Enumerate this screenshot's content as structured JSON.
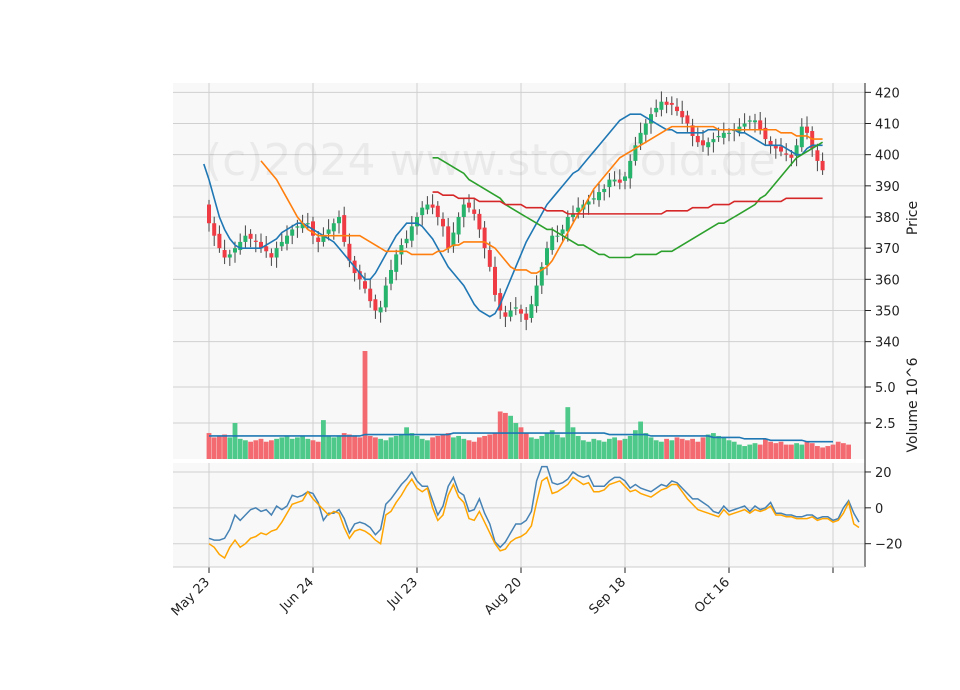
{
  "watermark": "(c)2024 www.stockfold.de",
  "chart_data": {
    "type": "candlestick",
    "x_ticks": [
      {
        "label": "May 23",
        "index": 0
      },
      {
        "label": "Jun 24",
        "index": 20
      },
      {
        "label": "Jul 23",
        "index": 40
      },
      {
        "label": "Aug 20",
        "index": 60
      },
      {
        "label": "Sep 18",
        "index": 80
      },
      {
        "label": "Oct 16",
        "index": 100
      },
      {
        "label": "",
        "index": 120
      }
    ],
    "price_panel": {
      "ylabel": "Price",
      "ylim": [
        337,
        423
      ],
      "yticks": [
        340,
        350,
        360,
        370,
        380,
        390,
        400,
        410,
        420
      ],
      "close": [
        378,
        374,
        370,
        367,
        368,
        370,
        372,
        374,
        373,
        372,
        370,
        369,
        367,
        370,
        372,
        374,
        376,
        377,
        378,
        378,
        374,
        372,
        374,
        376,
        378,
        380,
        372,
        366,
        362,
        360,
        357,
        353,
        350,
        351,
        358,
        363,
        368,
        371,
        373,
        377,
        380,
        383,
        384,
        383,
        380,
        377,
        370,
        375,
        380,
        384,
        383,
        381,
        376,
        370,
        364,
        355,
        350,
        348,
        350,
        351,
        349,
        347,
        352,
        358,
        364,
        370,
        374,
        374,
        376,
        380,
        381,
        383,
        384,
        385,
        386,
        388,
        389,
        392,
        392,
        391,
        393,
        398,
        403,
        407,
        410,
        413,
        415,
        417,
        416,
        416,
        414,
        412,
        410,
        406,
        404,
        403,
        404,
        405,
        406,
        407,
        407,
        408,
        409,
        410,
        411,
        411,
        408,
        405,
        403,
        402,
        401,
        400,
        399,
        403,
        409,
        407,
        402,
        398,
        395
      ],
      "series": [
        {
          "name": "MA10",
          "color": "#1f77b4",
          "values": [
            397,
            392,
            386,
            380,
            376,
            373,
            371,
            370,
            370,
            370,
            370,
            370,
            371,
            372,
            373,
            375,
            376,
            377,
            378,
            378,
            377,
            376,
            375,
            374,
            373,
            372,
            370,
            368,
            366,
            364,
            362,
            360,
            360,
            362,
            365,
            368,
            371,
            374,
            376,
            378,
            378,
            378,
            377,
            375,
            373,
            370,
            367,
            364,
            362,
            360,
            358,
            355,
            352,
            350,
            349,
            348,
            349,
            352,
            356,
            360,
            364,
            368,
            372,
            375,
            378,
            381,
            384,
            386,
            388,
            390,
            392,
            394,
            395,
            397,
            399,
            401,
            403,
            405,
            407,
            409,
            411,
            412,
            413,
            413,
            413,
            412,
            411,
            410,
            409,
            408,
            408,
            407,
            407,
            407,
            407,
            407,
            407,
            408,
            408,
            408,
            408,
            408,
            408,
            407,
            407,
            406,
            405,
            404,
            403,
            403,
            403,
            403,
            402,
            401,
            400,
            400,
            402,
            403,
            403,
            403
          ]
        },
        {
          "name": "MA20",
          "color": "#ff7f0e",
          "values": [
            398,
            396,
            394,
            392,
            389,
            386,
            383,
            380,
            378,
            376,
            375,
            374,
            374,
            374,
            374,
            374,
            374,
            374,
            374,
            374,
            373,
            372,
            371,
            370,
            369,
            369,
            369,
            369,
            369,
            368,
            368,
            368,
            368,
            368,
            369,
            369,
            370,
            371,
            371,
            372,
            372,
            372,
            372,
            372,
            371,
            370,
            368,
            366,
            364,
            363,
            363,
            363,
            362,
            362,
            363,
            364,
            366,
            369,
            372,
            375,
            378,
            381,
            383,
            386,
            389,
            391,
            393,
            395,
            397,
            399,
            400,
            401,
            402,
            403,
            404,
            405,
            406,
            407,
            408,
            409,
            409,
            409,
            409,
            409,
            409,
            409,
            409,
            409,
            408,
            408,
            408,
            408,
            408,
            408,
            408,
            408,
            408,
            408,
            408,
            408,
            407,
            407,
            407,
            406,
            406,
            406,
            405,
            405,
            405
          ]
        },
        {
          "name": "MA50",
          "color": "#2ca02c",
          "values": [
            399,
            399,
            398,
            397,
            396,
            395,
            394,
            392,
            391,
            390,
            389,
            388,
            387,
            386,
            384,
            383,
            382,
            381,
            380,
            379,
            378,
            377,
            376,
            376,
            375,
            374,
            373,
            372,
            371,
            371,
            370,
            369,
            368,
            368,
            367,
            367,
            367,
            367,
            367,
            368,
            368,
            368,
            368,
            368,
            369,
            369,
            369,
            370,
            371,
            372,
            373,
            374,
            375,
            376,
            377,
            378,
            378,
            379,
            380,
            381,
            382,
            383,
            384,
            386,
            387,
            389,
            391,
            393,
            395,
            397,
            399,
            400,
            401,
            402,
            403,
            404
          ]
        },
        {
          "name": "MA200",
          "color": "#d62728",
          "values": [
            388,
            388,
            387,
            387,
            387,
            386,
            386,
            386,
            386,
            385,
            385,
            385,
            385,
            385,
            384,
            384,
            384,
            384,
            383,
            383,
            383,
            383,
            382,
            382,
            382,
            382,
            381,
            381,
            381,
            381,
            381,
            381,
            381,
            381,
            381,
            381,
            381,
            381,
            381,
            381,
            381,
            381,
            381,
            381,
            381,
            382,
            382,
            382,
            382,
            382,
            383,
            383,
            383,
            383,
            384,
            384,
            384,
            384,
            385,
            385,
            385,
            385,
            385,
            385,
            385,
            385,
            385,
            385,
            386,
            386,
            386,
            386,
            386,
            386,
            386,
            386
          ]
        }
      ]
    },
    "volume_panel": {
      "ylabel": "Volume  10^6",
      "ylim": [
        0,
        7.5
      ],
      "yticks": [
        2.5,
        5.0
      ],
      "values": [
        1.8,
        1.5,
        1.6,
        1.7,
        1.5,
        2.5,
        1.4,
        1.3,
        1.2,
        1.3,
        1.4,
        1.2,
        1.3,
        1.4,
        1.5,
        1.6,
        1.4,
        1.5,
        1.6,
        1.4,
        1.3,
        1.2,
        2.7,
        1.6,
        1.5,
        1.6,
        1.8,
        1.7,
        1.6,
        1.5,
        7.8,
        1.6,
        1.5,
        1.4,
        1.3,
        1.5,
        1.6,
        1.7,
        2.2,
        1.8,
        1.6,
        1.4,
        1.3,
        1.5,
        1.6,
        1.7,
        1.8,
        1.5,
        1.6,
        1.4,
        1.3,
        1.2,
        1.5,
        1.6,
        1.7,
        1.8,
        3.3,
        3.2,
        3.0,
        2.5,
        2.2,
        1.8,
        1.5,
        1.4,
        1.6,
        1.8,
        2.0,
        1.7,
        1.5,
        3.6,
        2.2,
        1.6,
        1.3,
        1.2,
        1.4,
        1.3,
        1.2,
        1.4,
        1.5,
        1.3,
        1.4,
        1.6,
        2.0,
        2.6,
        1.8,
        1.5,
        1.3,
        1.2,
        1.4,
        1.3,
        1.5,
        1.4,
        1.3,
        1.4,
        1.2,
        1.5,
        1.7,
        1.8,
        1.6,
        1.5,
        1.3,
        1.2,
        1.0,
        0.9,
        1.0,
        1.1,
        1.0,
        1.4,
        1.2,
        1.1,
        1.2,
        1.0,
        1.0,
        1.1,
        1.0,
        1.2,
        1.1,
        0.9,
        0.8,
        0.9,
        1.0,
        1.2,
        1.1,
        1.0
      ],
      "avg_line": {
        "color": "#1f77b4",
        "values": [
          1.6,
          1.6,
          1.6,
          1.6,
          1.6,
          1.6,
          1.6,
          1.6,
          1.6,
          1.6,
          1.6,
          1.6,
          1.6,
          1.6,
          1.6,
          1.6,
          1.6,
          1.6,
          1.6,
          1.6,
          1.6,
          1.6,
          1.6,
          1.6,
          1.6,
          1.6,
          1.6,
          1.6,
          1.6,
          1.6,
          1.7,
          1.7,
          1.7,
          1.7,
          1.7,
          1.7,
          1.7,
          1.7,
          1.7,
          1.7,
          1.7,
          1.7,
          1.7,
          1.7,
          1.7,
          1.7,
          1.7,
          1.8,
          1.8,
          1.8,
          1.8,
          1.8,
          1.8,
          1.8,
          1.8,
          1.8,
          1.8,
          1.8,
          1.8,
          1.8,
          1.8,
          1.8,
          1.8,
          1.8,
          1.8,
          1.8,
          1.8,
          1.8,
          1.8,
          1.8,
          1.8,
          1.8,
          1.8,
          1.8,
          1.8,
          1.8,
          1.8,
          1.7,
          1.7,
          1.7,
          1.7,
          1.7,
          1.7,
          1.7,
          1.7,
          1.6,
          1.6,
          1.6,
          1.6,
          1.6,
          1.6,
          1.6,
          1.6,
          1.6,
          1.6,
          1.6,
          1.6,
          1.5,
          1.5,
          1.5,
          1.5,
          1.5,
          1.5,
          1.4,
          1.4,
          1.4,
          1.4,
          1.4,
          1.3,
          1.3,
          1.3,
          1.3,
          1.3,
          1.3,
          1.3,
          1.2,
          1.2,
          1.2,
          1.2,
          1.2,
          1.2
        ]
      }
    },
    "oscillator_panel": {
      "ylim": [
        -33,
        25
      ],
      "yticks": [
        -20,
        0,
        20
      ],
      "series": [
        {
          "name": "",
          "color": "#4682b4",
          "values": [
            -17,
            -18,
            -18,
            -17,
            -12,
            -4,
            -7,
            -4,
            -1,
            0,
            -2,
            -1,
            -4,
            1,
            -1,
            1,
            7,
            6,
            7,
            9,
            8,
            3,
            -7,
            -3,
            -3,
            -1,
            -6,
            -14,
            -9,
            -8,
            -9,
            -11,
            -15,
            -12,
            2,
            5,
            9,
            13,
            16,
            20,
            15,
            12,
            12,
            4,
            -4,
            1,
            12,
            17,
            9,
            7,
            -2,
            -1,
            5,
            -3,
            -9,
            -19,
            -22,
            -19,
            -14,
            -9,
            -9,
            -7,
            -2,
            15,
            23,
            23,
            14,
            13,
            14,
            16,
            20,
            18,
            17,
            18,
            12,
            12,
            12,
            15,
            17,
            17,
            15,
            11,
            13,
            11,
            10,
            9,
            11,
            13,
            12,
            15,
            14,
            11,
            8,
            5,
            5,
            3,
            1,
            -2,
            -3,
            1,
            -2,
            -1,
            0,
            1,
            -2,
            1,
            -1,
            0,
            3,
            -3,
            -3,
            -4,
            -4,
            -5,
            -5,
            -4,
            -4,
            -6,
            -5,
            -5,
            -7,
            -6,
            0,
            4,
            -3,
            -8
          ]
        },
        {
          "name": "",
          "color": "#ffa500",
          "values": [
            -20,
            -22,
            -26,
            -28,
            -22,
            -18,
            -22,
            -20,
            -17,
            -16,
            -14,
            -15,
            -13,
            -12,
            -8,
            -3,
            2,
            3,
            4,
            9,
            5,
            2,
            -1,
            -4,
            -2,
            -3,
            -11,
            -17,
            -13,
            -12,
            -13,
            -15,
            -18,
            -20,
            -4,
            -2,
            3,
            7,
            12,
            16,
            11,
            9,
            11,
            0,
            -7,
            -4,
            7,
            13,
            6,
            3,
            -6,
            -7,
            -2,
            -8,
            -14,
            -20,
            -24,
            -23,
            -19,
            -17,
            -16,
            -14,
            -10,
            3,
            15,
            17,
            8,
            9,
            11,
            13,
            17,
            15,
            13,
            14,
            9,
            9,
            10,
            13,
            14,
            15,
            12,
            9,
            10,
            8,
            7,
            6,
            8,
            10,
            11,
            13,
            13,
            9,
            5,
            2,
            -1,
            -2,
            -3,
            -4,
            -5,
            -1,
            -4,
            -3,
            -2,
            -1,
            -3,
            -1,
            -2,
            -1,
            1,
            -4,
            -4,
            -5,
            -5,
            -6,
            -6,
            -6,
            -5,
            -7,
            -6,
            -6,
            -8,
            -7,
            -3,
            3,
            -9,
            -11
          ]
        }
      ]
    }
  }
}
